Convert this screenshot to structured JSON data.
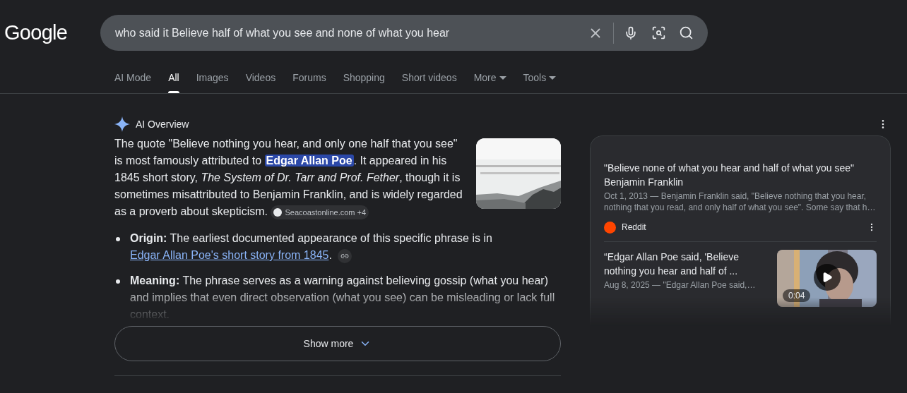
{
  "logo": "Google",
  "search": {
    "value": "who said it Believe half of what you see and none of what you hear"
  },
  "tabs": [
    {
      "label": "AI Mode",
      "selected": false,
      "dropdown": false
    },
    {
      "label": "All",
      "selected": true,
      "dropdown": false
    },
    {
      "label": "Images",
      "selected": false,
      "dropdown": false
    },
    {
      "label": "Videos",
      "selected": false,
      "dropdown": false
    },
    {
      "label": "Forums",
      "selected": false,
      "dropdown": false
    },
    {
      "label": "Shopping",
      "selected": false,
      "dropdown": false
    },
    {
      "label": "Short videos",
      "selected": false,
      "dropdown": false
    },
    {
      "label": "More",
      "selected": false,
      "dropdown": true
    },
    {
      "label": "Tools",
      "selected": false,
      "dropdown": true
    }
  ],
  "overview": {
    "title": "AI Overview",
    "paragraph": "The quote \"Believe nothing you hear, and only one half that you see\" is most famously attributed to **Edgar Allan Poe**. It appeared in his 1845 short story, *The System of Dr. Tarr and Prof. Fether*, though it is sometimes misattributed to Benjamin Franklin, and is widely regarded as a proverb about skepticism.",
    "source_chip": "Seacoastonline.com +4",
    "bullets": [
      {
        "term": "Origin:",
        "text": "The earliest documented appearance of this specific phrase is in ",
        "link": "Edgar Allan Poe's short story from 1845",
        "after": "."
      },
      {
        "term": "Meaning:",
        "text": "The phrase serves as a warning against believing gossip (what you hear) and implies that even direct observation (what you see) can be misleading or lack full context."
      }
    ],
    "show_more": "Show more"
  },
  "results": [
    {
      "kind": "text",
      "title": "\"Believe none of what you hear and half of what you see\" Benjamin Franklin",
      "snippet": "Oct 1, 2013 — Benjamin Franklin said, \"Believe nothing that you hear, nothing that you read, and only half of what you see\". Some say that h…",
      "source": "Reddit"
    },
    {
      "kind": "video",
      "title": "“Edgar Allan Poe said, 'Believe nothing you hear and half of ...",
      "snippet": "Aug 8, 2025 — \"Edgar Allan Poe said,…",
      "duration": "0:04"
    }
  ]
}
